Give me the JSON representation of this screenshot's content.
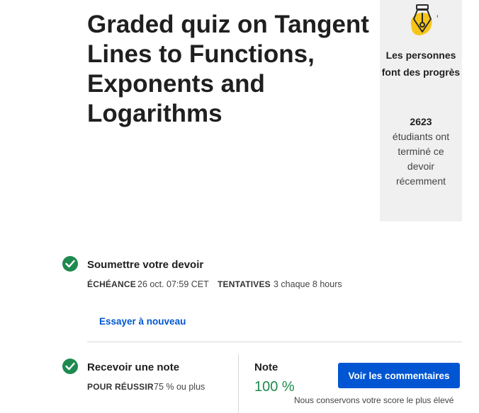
{
  "quiz": {
    "title": "Graded quiz on Tangent Lines to Functions, Exponents and Logarithms"
  },
  "progress_card": {
    "icon": "pen-nib-icon",
    "accent_color": "#f5c518",
    "apostrophe": "'",
    "heading": "Les personnes font des progrès",
    "count": "2623",
    "description": "étudiants ont terminé ce devoir récemment"
  },
  "submit_step": {
    "title": "Soumettre votre devoir",
    "deadline_label": "ÉCHÉANCE",
    "deadline_value": "26 oct. 07:59 CET",
    "attempts_label": "TENTATIVES",
    "attempts_value": "3 chaque 8  hours",
    "retry_link": "Essayer à nouveau"
  },
  "grade_step": {
    "title": "Recevoir une note",
    "pass_label": "POUR RÉUSSIR",
    "pass_value": "75 % ou plus",
    "grade_label": "Note",
    "grade_value": "100 %",
    "feedback_button": "Voir les commentaires",
    "keep_note": "Nous conservons votre score le plus élevé"
  },
  "colors": {
    "success": "#1e8a4f",
    "primary": "#0056d2",
    "card_bg": "#f0f0f0"
  }
}
